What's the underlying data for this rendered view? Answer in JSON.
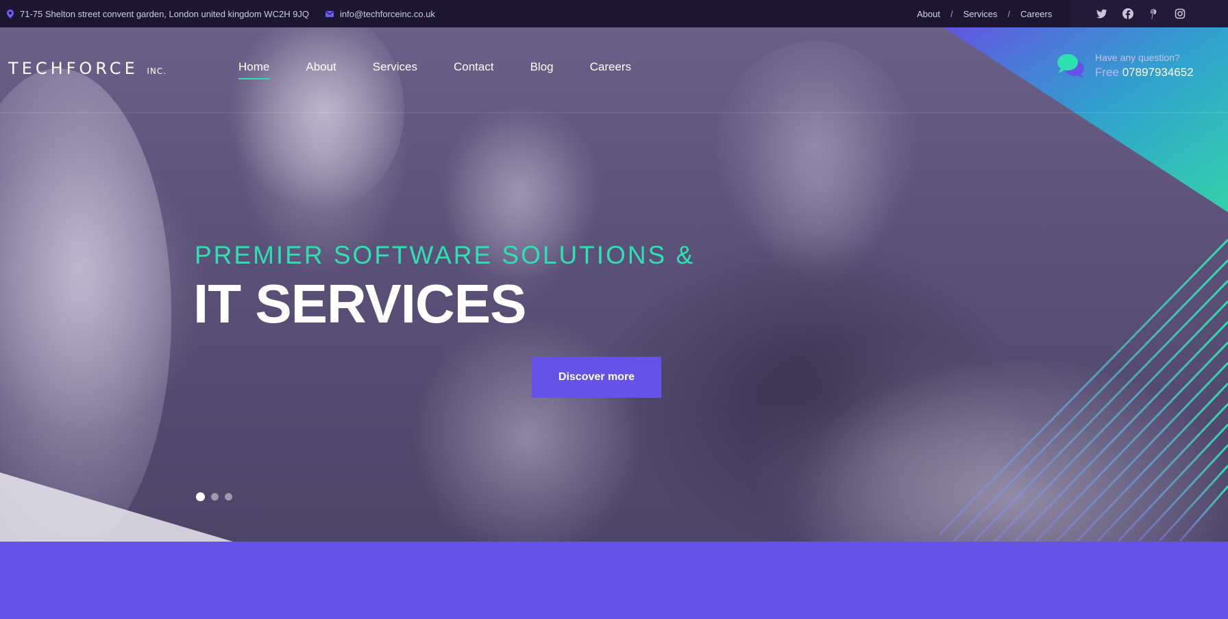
{
  "topbar": {
    "address": "71-75 Shelton street convent garden, London united kingdom WC2H 9JQ",
    "email": "info@techforceinc.co.uk",
    "links": [
      "About",
      "Services",
      "Careers"
    ],
    "separator": "/",
    "social_icons": [
      "twitter-icon",
      "facebook-icon",
      "pinterest-icon",
      "instagram-icon"
    ]
  },
  "header": {
    "logo_text": "TECHFORCE",
    "logo_suffix": "INC.",
    "nav": [
      "Home",
      "About",
      "Services",
      "Contact",
      "Blog",
      "Careers"
    ],
    "active_nav": "Home",
    "question": "Have any question?",
    "phone_prefix": "Free",
    "phone": "07897934652"
  },
  "hero": {
    "subtitle": "PREMIER SOFTWARE SOLUTIONS &",
    "title": "IT SERVICES",
    "cta": "Discover more",
    "slides_total": 3,
    "active_slide": 1
  },
  "colors": {
    "accent": "#6453e6",
    "teal": "#2fe0b0",
    "topbar_bg": "#1d1630"
  }
}
